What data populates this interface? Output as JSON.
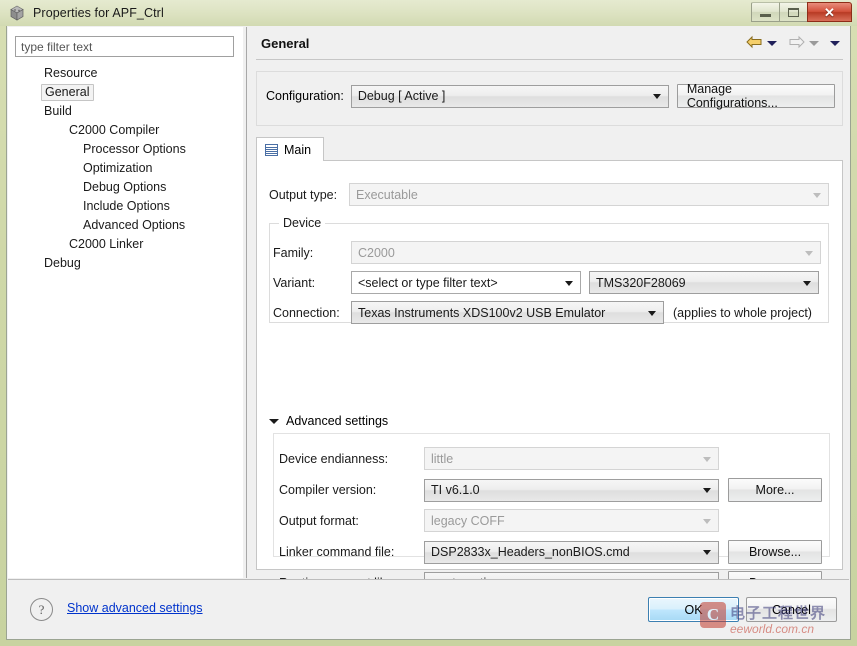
{
  "window": {
    "title": "Properties for APF_Ctrl",
    "icon": "cube-icon",
    "controls": {
      "minimize": "minimize-button",
      "maximize": "maximize-button",
      "close": "close-button",
      "close_glyph": "✕"
    }
  },
  "sidebar": {
    "filter": {
      "placeholder": "type filter text",
      "value": "type filter text"
    },
    "items": [
      {
        "label": "Resource",
        "depth": 1,
        "selected": false
      },
      {
        "label": "General",
        "depth": 1,
        "selected": true
      },
      {
        "label": "Build",
        "depth": 1,
        "selected": false
      },
      {
        "label": "C2000 Compiler",
        "depth": 2,
        "selected": false
      },
      {
        "label": "Processor Options",
        "depth": 3,
        "selected": false
      },
      {
        "label": "Optimization",
        "depth": 3,
        "selected": false
      },
      {
        "label": "Debug Options",
        "depth": 3,
        "selected": false
      },
      {
        "label": "Include Options",
        "depth": 3,
        "selected": false
      },
      {
        "label": "Advanced Options",
        "depth": 3,
        "selected": false
      },
      {
        "label": "C2000 Linker",
        "depth": 2,
        "selected": false
      },
      {
        "label": "Debug",
        "depth": 1,
        "selected": false
      }
    ]
  },
  "page": {
    "title": "General",
    "nav": {
      "back_icon": "back-arrow-icon",
      "back_menu_icon": "chevron-down-icon",
      "forward_icon": "forward-arrow-icon",
      "forward_menu_icon": "chevron-down-icon",
      "view_menu_icon": "chevron-down-icon"
    },
    "configuration": {
      "label": "Configuration:",
      "value": "Debug  [ Active ]",
      "manage_button": "Manage Configurations..."
    },
    "tab": {
      "label": "Main",
      "icon": "table-icon"
    },
    "output_type": {
      "label": "Output type:",
      "value": "Executable",
      "disabled": true
    },
    "device": {
      "group_title": "Device",
      "family": {
        "label": "Family:",
        "value": "C2000",
        "disabled": true
      },
      "variant": {
        "label": "Variant:",
        "filter_value": "<select or type filter text>",
        "device_value": "TMS320F28069"
      },
      "connection": {
        "label": "Connection:",
        "value": "Texas Instruments XDS100v2 USB Emulator",
        "note": "(applies to whole project)"
      }
    },
    "advanced": {
      "toggle_label": "Advanced settings",
      "toggle_icon": "triangle-down-icon",
      "rows": [
        {
          "label": "Device endianness:",
          "value": "little",
          "disabled": true,
          "button": null
        },
        {
          "label": "Compiler version:",
          "value": "TI v6.1.0",
          "disabled": false,
          "button": "More..."
        },
        {
          "label": "Output format:",
          "value": "legacy COFF",
          "disabled": true,
          "button": null
        },
        {
          "label": "Linker command file:",
          "value": "DSP2833x_Headers_nonBIOS.cmd",
          "disabled": false,
          "button": "Browse..."
        },
        {
          "label": "Runtime support library:",
          "value": "<automatic>",
          "disabled": false,
          "button": "Browse..."
        }
      ]
    }
  },
  "footer": {
    "help_icon": "help-question-icon",
    "help_glyph": "?",
    "advanced_link": "Show advanced settings",
    "ok_button": "OK",
    "cancel_button": "Cancel"
  },
  "watermark": {
    "logo_glyph": "C",
    "cn_text": "电子工程世界",
    "en_text": "eeworld.com.cn"
  },
  "colors": {
    "titlebar": "#d8dfb4",
    "close_red": "#c8452c",
    "link_blue": "#0033cc",
    "ok_blue": "#3c7fb1",
    "accent_tab": "#4a6fa5"
  }
}
